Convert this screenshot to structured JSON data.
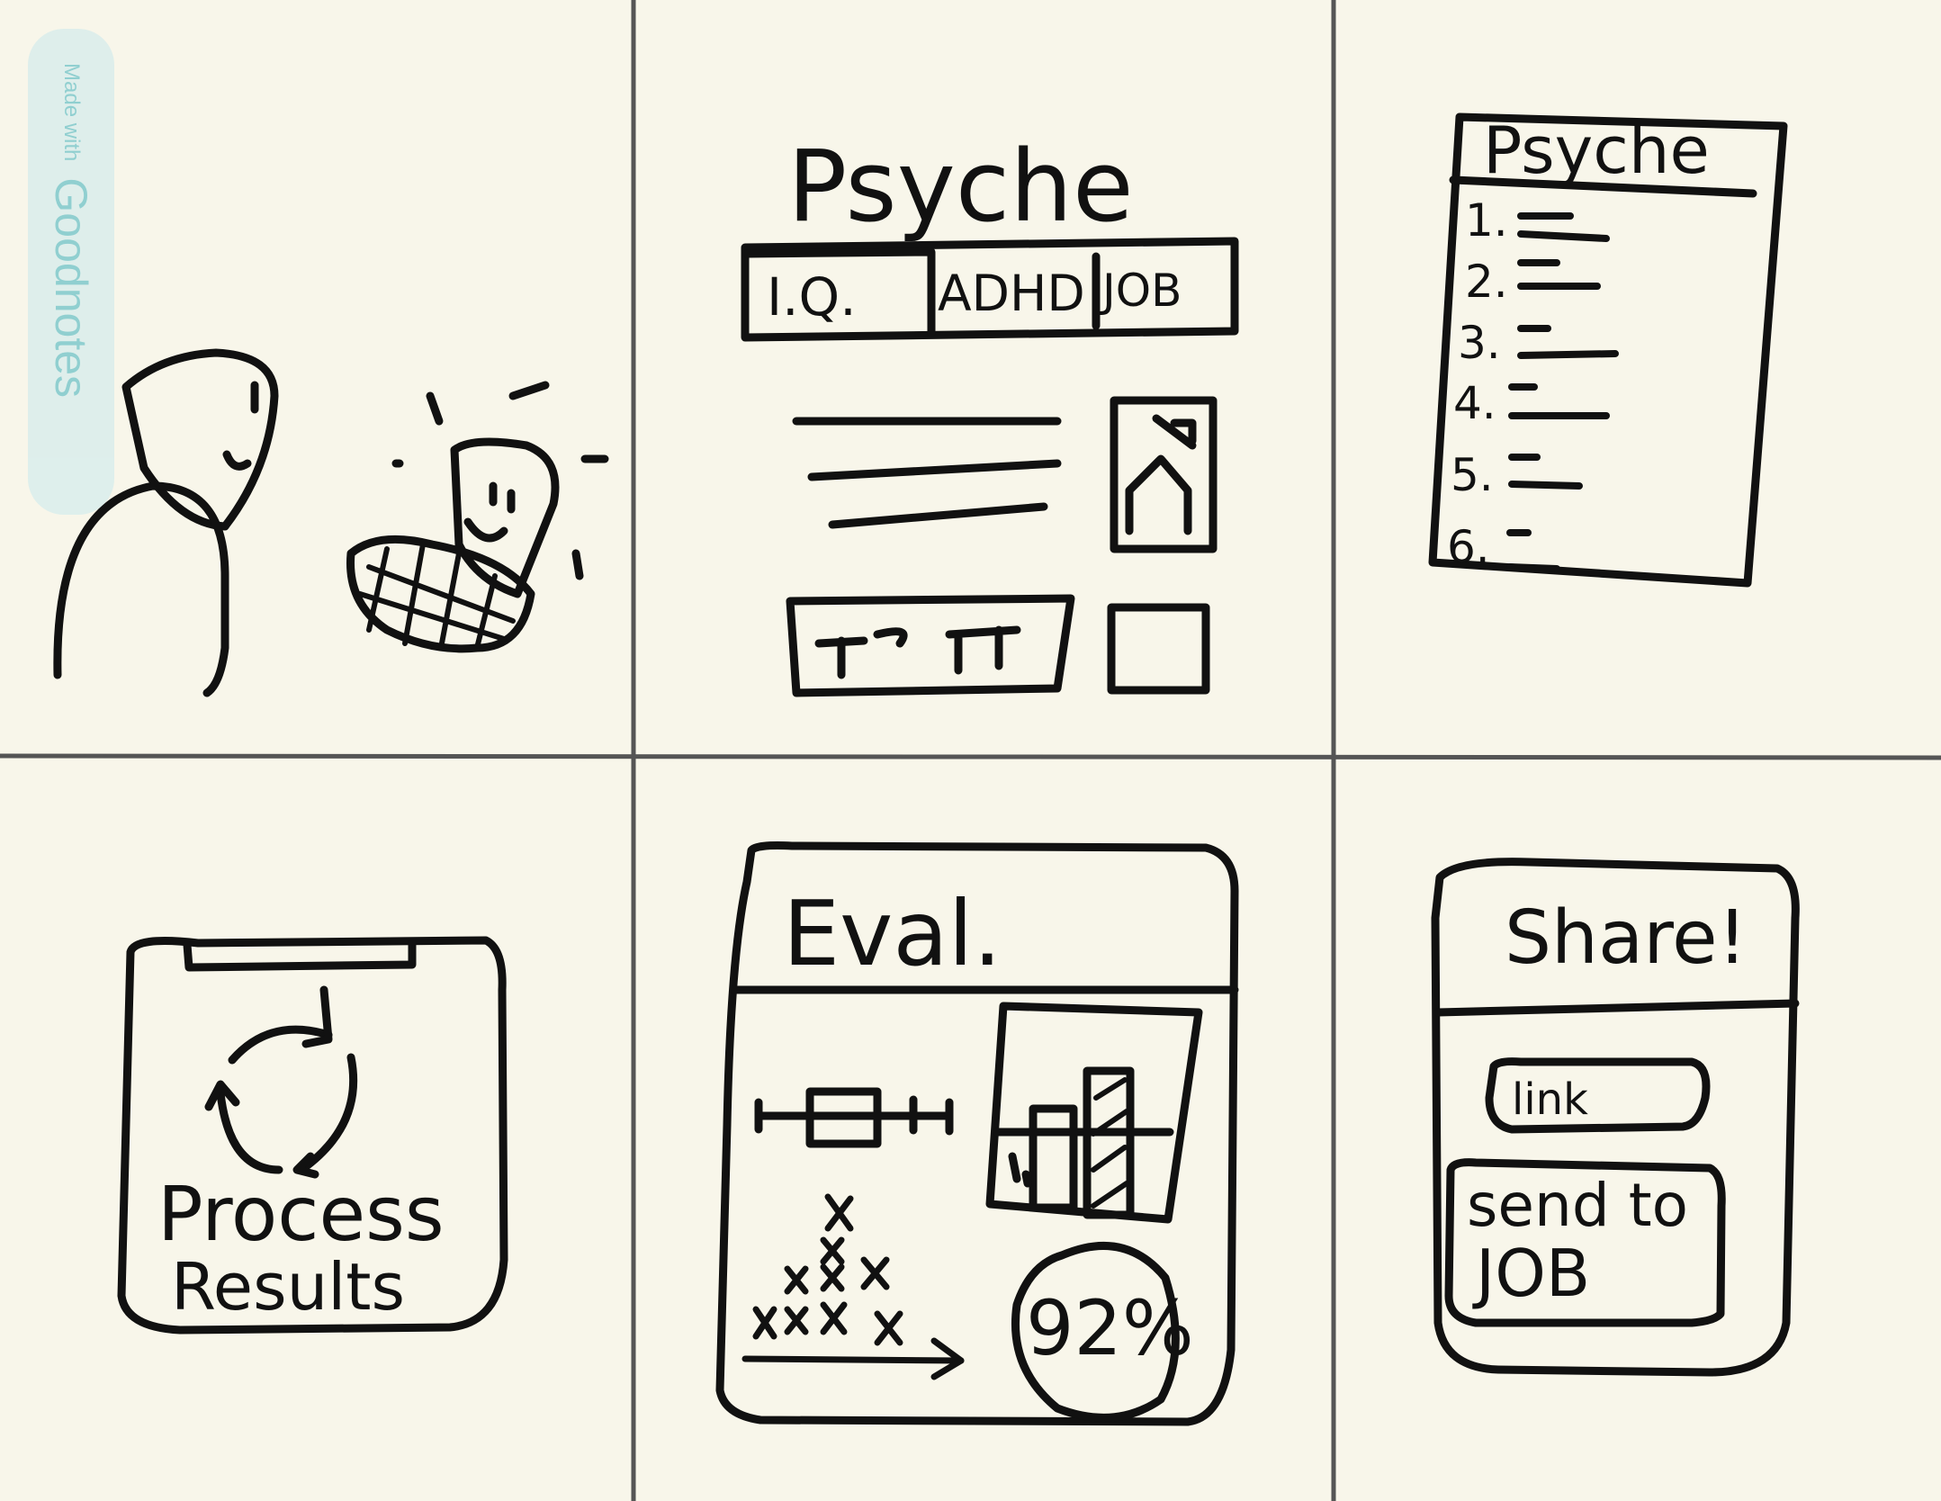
{
  "watermark": {
    "prefix": "Made with",
    "brand": "Goodnotes"
  },
  "panel2": {
    "title": "Psyche",
    "tabs": [
      "I.Q.",
      "ADHD",
      "JOB"
    ]
  },
  "panel3": {
    "title": "Psyche",
    "items": [
      "1.",
      "2.",
      "3.",
      "4.",
      "5.",
      "6."
    ]
  },
  "panel4": {
    "line1": "Process",
    "line2": "Results"
  },
  "panel5": {
    "title": "Eval.",
    "score": "92%"
  },
  "panel6": {
    "title": "Share!",
    "link_button": "link",
    "send_button_line1": "send to",
    "send_button_line2": "JOB"
  },
  "colors": {
    "ink": "#111111",
    "paper": "#f8f6ea",
    "grid": "#555555",
    "watermark": "#6ec3c8"
  }
}
